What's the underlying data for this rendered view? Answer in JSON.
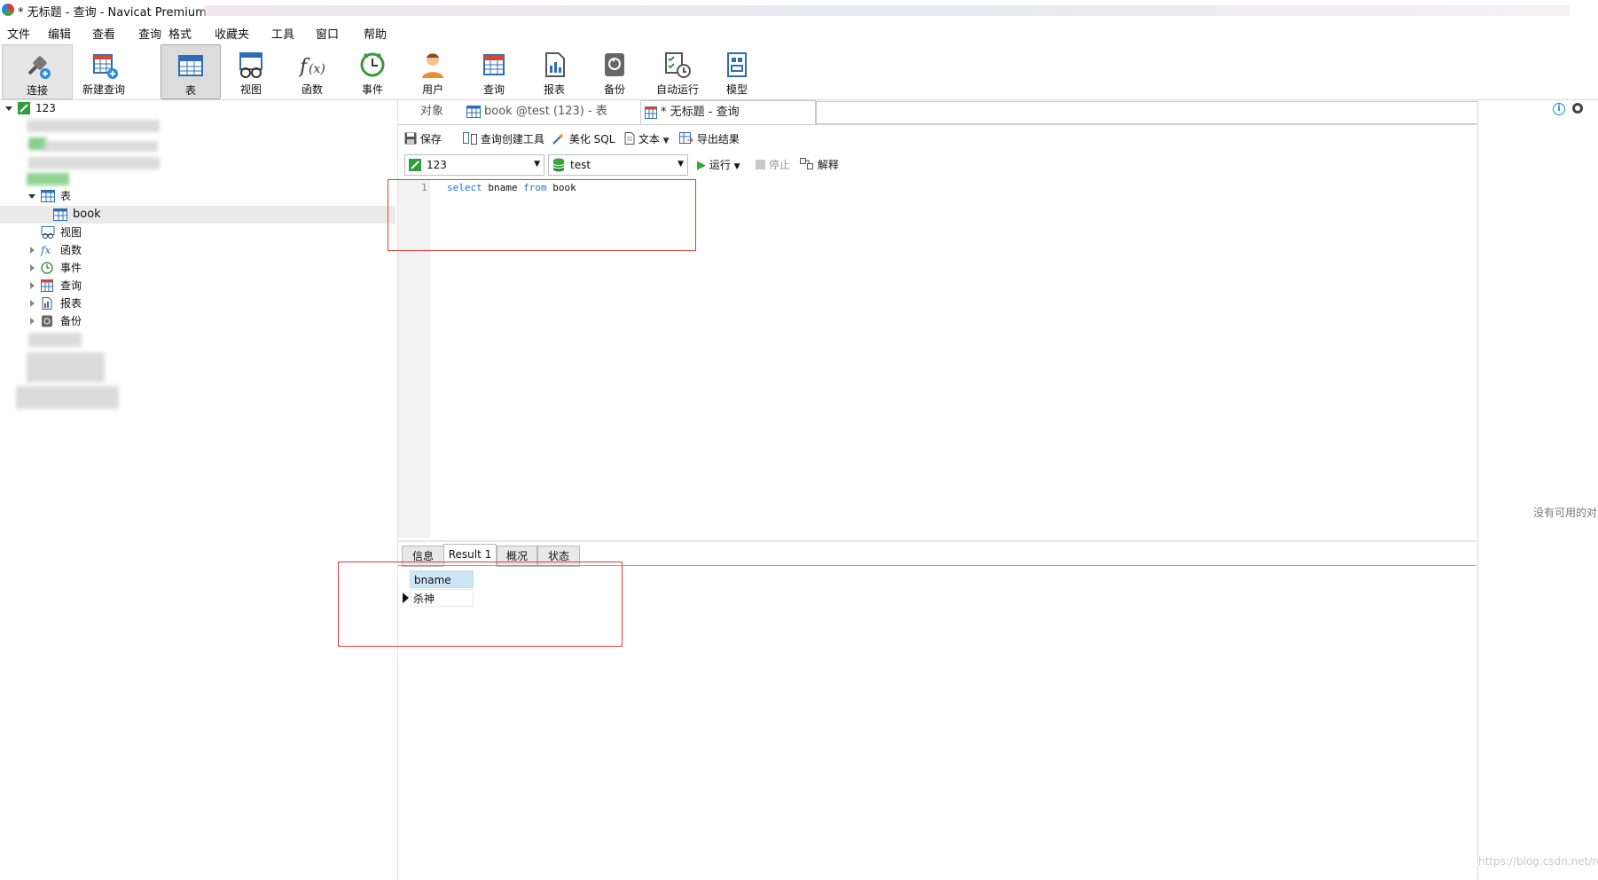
{
  "window": {
    "title": "* 无标题 - 查询 - Navicat Premium"
  },
  "menu": [
    "文件",
    "编辑",
    "查看",
    "查询",
    "格式",
    "收藏夹",
    "工具",
    "窗口",
    "帮助"
  ],
  "toolbar": {
    "buttons": [
      {
        "label": "连接",
        "icon": "plug-icon"
      },
      {
        "label": "新建查询",
        "icon": "new-query-icon"
      },
      {
        "label": "表",
        "icon": "table-icon"
      },
      {
        "label": "视图",
        "icon": "view-icon"
      },
      {
        "label": "函数",
        "icon": "function-icon"
      },
      {
        "label": "事件",
        "icon": "clock-icon"
      },
      {
        "label": "用户",
        "icon": "user-icon"
      },
      {
        "label": "查询",
        "icon": "query-icon"
      },
      {
        "label": "报表",
        "icon": "report-icon"
      },
      {
        "label": "备份",
        "icon": "backup-icon"
      },
      {
        "label": "自动运行",
        "icon": "schedule-icon"
      },
      {
        "label": "模型",
        "icon": "model-icon"
      }
    ],
    "selected": "表"
  },
  "tree": {
    "connection": "123",
    "table_group": "表",
    "table": "book",
    "nodes": [
      "视图",
      "函数",
      "事件",
      "查询",
      "报表",
      "备份"
    ]
  },
  "tabs": {
    "objects": "对象",
    "table_tab": "book @test (123) - 表",
    "query_tab": "* 无标题 - 查询"
  },
  "query_toolbar": {
    "save": "保存",
    "builder": "查询创建工具",
    "beautify": "美化 SQL",
    "text": "文本",
    "export": "导出结果"
  },
  "connection_select": {
    "value": "123"
  },
  "database_select": {
    "value": "test"
  },
  "run": {
    "run": "运行",
    "stop": "停止",
    "explain": "解释"
  },
  "editor": {
    "line_number": "1",
    "kw_select": "select",
    "col": "bname",
    "kw_from": "from",
    "table": "book"
  },
  "result_tabs": [
    "信息",
    "Result 1",
    "概况",
    "状态"
  ],
  "result": {
    "column": "bname",
    "rows": [
      "杀神"
    ]
  },
  "right_panel": {
    "empty_text": "没有可用的对象"
  },
  "watermark": "https://blog.csdn.net/residualice",
  "colors": {
    "keyword": "#1e6fd9",
    "highlight_box": "#e53935",
    "header_bg": "#cbe6f7"
  }
}
